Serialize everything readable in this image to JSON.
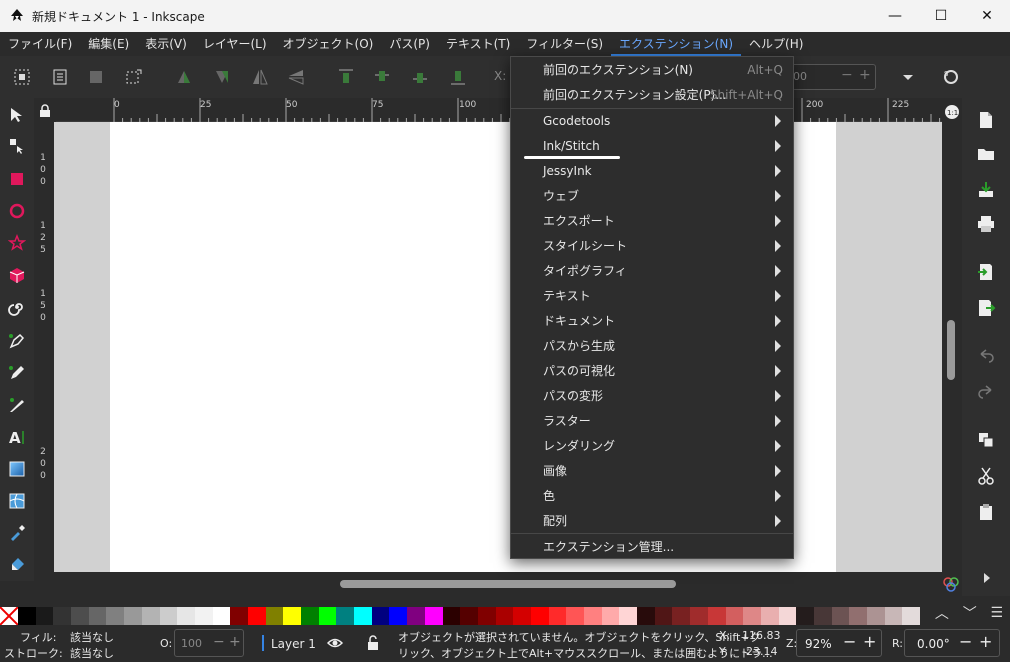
{
  "window": {
    "title": "新規ドキュメント 1 - Inkscape",
    "minimize": "—",
    "maximize": "☐",
    "close": "✕"
  },
  "menubar": [
    {
      "label": "ファイル(F)"
    },
    {
      "label": "編集(E)"
    },
    {
      "label": "表示(V)"
    },
    {
      "label": "レイヤー(L)"
    },
    {
      "label": "オブジェクト(O)"
    },
    {
      "label": "パス(P)"
    },
    {
      "label": "テキスト(T)"
    },
    {
      "label": "フィルター(S)"
    },
    {
      "label": "エクステンション(N)",
      "active": true
    },
    {
      "label": "ヘルプ(H)"
    }
  ],
  "toolbar": {
    "x_label": "X:",
    "w_value": "00"
  },
  "ruler_top": [
    "0",
    "25",
    "50",
    "75",
    "100",
    "200",
    "225"
  ],
  "ruler_left": [
    "1",
    "0",
    "0",
    "1",
    "2",
    "5",
    "1",
    "5",
    "0",
    "2",
    "0",
    "0"
  ],
  "extensions_menu": {
    "items": [
      {
        "label": "前回のエクステンション(N)",
        "accel": "Alt+Q",
        "submenu": false
      },
      {
        "label": "前回のエクステンション設定(P)...",
        "accel": "Shift+Alt+Q",
        "submenu": false
      },
      {
        "label": "Gcodetools",
        "submenu": true
      },
      {
        "label": "Ink/Stitch",
        "submenu": true
      },
      {
        "label": "JessyInk",
        "submenu": true
      },
      {
        "label": "ウェブ",
        "submenu": true
      },
      {
        "label": "エクスポート",
        "submenu": true
      },
      {
        "label": "スタイルシート",
        "submenu": true
      },
      {
        "label": "タイポグラフィ",
        "submenu": true
      },
      {
        "label": "テキスト",
        "submenu": true
      },
      {
        "label": "ドキュメント",
        "submenu": true
      },
      {
        "label": "パスから生成",
        "submenu": true
      },
      {
        "label": "パスの可視化",
        "submenu": true
      },
      {
        "label": "パスの変形",
        "submenu": true
      },
      {
        "label": "ラスター",
        "submenu": true
      },
      {
        "label": "レンダリング",
        "submenu": true
      },
      {
        "label": "画像",
        "submenu": true
      },
      {
        "label": "色",
        "submenu": true
      },
      {
        "label": "配列",
        "submenu": true
      },
      {
        "label": "エクステンション管理...",
        "submenu": false
      }
    ]
  },
  "palette": [
    "#000000",
    "#1a1a1a",
    "#333333",
    "#4d4d4d",
    "#666666",
    "#808080",
    "#999999",
    "#b3b3b3",
    "#cccccc",
    "#e6e6e6",
    "#f2f2f2",
    "#ffffff",
    "#800000",
    "#ff0000",
    "#808000",
    "#ffff00",
    "#008000",
    "#00ff00",
    "#008080",
    "#00ffff",
    "#000080",
    "#0000ff",
    "#800080",
    "#ff00ff",
    "#2b0000",
    "#550000",
    "#800000",
    "#aa0000",
    "#d40000",
    "#ff0000",
    "#ff2a2a",
    "#ff5555",
    "#ff8080",
    "#ffaaaa",
    "#ffd5d5",
    "#280b0b",
    "#501616",
    "#782121",
    "#a02c2c",
    "#c83737",
    "#d35f5f",
    "#de8787",
    "#e9afaf",
    "#f4d7d7",
    "#241c1c",
    "#483737",
    "#6c5353",
    "#916f6f",
    "#ac9393",
    "#c8b7b7",
    "#e3dbdb"
  ],
  "status": {
    "fill_label": "フィル:",
    "fill_value": "該当なし",
    "stroke_label": "ストローク:",
    "stroke_value": "該当なし",
    "opacity_label": "O:",
    "opacity_value": "100",
    "layer": "Layer 1",
    "message_line1": "オブジェクトが選択されていません。オブジェクトをクリック、Shift+ク",
    "message_line2": "リック、オブジェクト上でAlt+マウススクロール、または囲むようにドラ...",
    "x_label": "X:",
    "x_value": "116.83",
    "y_label": "Y:",
    "y_value": "-23.14",
    "zoom_label": "Z:",
    "zoom_value": "92%",
    "rotate_label": "R:",
    "rotate_value": "0.00°"
  },
  "colors": {
    "accent": "#3584e4",
    "menu_bg": "#2d2d2d",
    "canvas_bg": "#d1d1d1"
  }
}
